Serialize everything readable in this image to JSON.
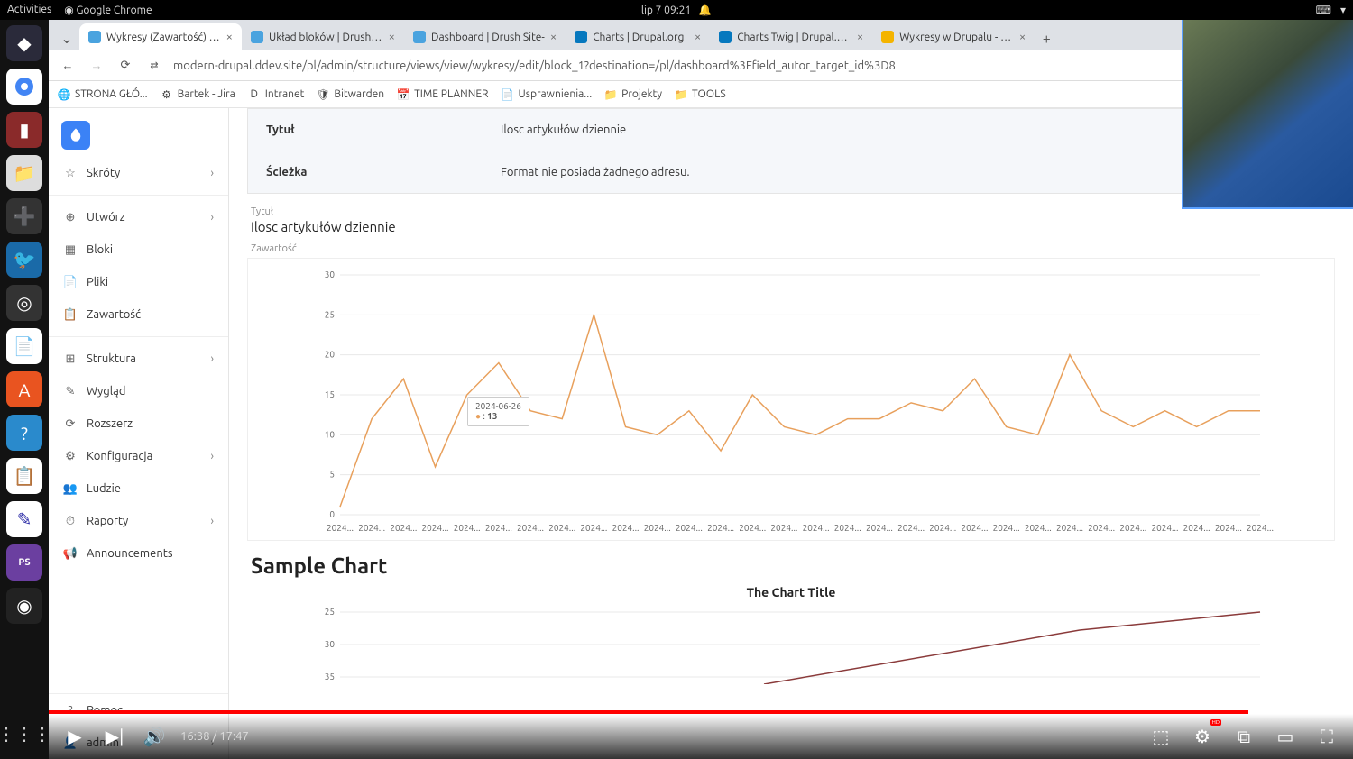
{
  "gnome": {
    "activities": "Activities",
    "app": "Google Chrome",
    "clock": "lip 7  09:21"
  },
  "tabs": [
    {
      "title": "Wykresy (Zawartość) | D",
      "active": true,
      "favicon": "#4aa3df"
    },
    {
      "title": "Układ bloków | Drush Sit",
      "active": false,
      "favicon": "#4aa3df"
    },
    {
      "title": "Dashboard | Drush Site-",
      "active": false,
      "favicon": "#4aa3df"
    },
    {
      "title": "Charts | Drupal.org",
      "active": false,
      "favicon": "#0678be"
    },
    {
      "title": "Charts Twig | Drupal.org",
      "active": false,
      "favicon": "#0678be"
    },
    {
      "title": "Wykresy w Drupalu - Pre",
      "active": false,
      "favicon": "#f4b400"
    }
  ],
  "address": "modern-drupal.ddev.site/pl/admin/structure/views/view/wykresy/edit/block_1?destination=/pl/dashboard%3Ffield_autor_target_id%3D8",
  "bookmarks": [
    {
      "label": "STRONA GŁÓ...",
      "icon": "🌐"
    },
    {
      "label": "Bartek - Jira",
      "icon": "⚙"
    },
    {
      "label": "Intranet",
      "icon": "D"
    },
    {
      "label": "Bitwarden",
      "icon": "🛡"
    },
    {
      "label": "TIME PLANNER",
      "icon": "📅"
    },
    {
      "label": "Usprawnienia...",
      "icon": "📄"
    },
    {
      "label": "Projekty",
      "icon": "📁"
    },
    {
      "label": "TOOLS",
      "icon": "📁"
    }
  ],
  "sidebar": {
    "items": [
      {
        "label": "Skróty",
        "icon": "☆",
        "chev": true
      },
      {
        "label": "Utwórz",
        "icon": "⊕",
        "chev": true
      },
      {
        "label": "Bloki",
        "icon": "▦",
        "chev": false
      },
      {
        "label": "Pliki",
        "icon": "📄",
        "chev": false
      },
      {
        "label": "Zawartość",
        "icon": "📋",
        "chev": false
      },
      {
        "label": "Struktura",
        "icon": "⊞",
        "chev": true
      },
      {
        "label": "Wygląd",
        "icon": "✎",
        "chev": false
      },
      {
        "label": "Rozszerz",
        "icon": "⟳",
        "chev": false
      },
      {
        "label": "Konfiguracja",
        "icon": "⚙",
        "chev": true
      },
      {
        "label": "Ludzie",
        "icon": "👥",
        "chev": false
      },
      {
        "label": "Raporty",
        "icon": "⏱",
        "chev": true
      },
      {
        "label": "Announcements",
        "icon": "📢",
        "chev": false
      }
    ],
    "bottom": [
      {
        "label": "Pomoc",
        "icon": "?"
      },
      {
        "label": "admin",
        "icon": "👤",
        "chev": true
      }
    ]
  },
  "info": {
    "row1_label": "Tytuł",
    "row1_value": "Ilosc artykułów dziennie",
    "row2_label": "Ścieżka",
    "row2_value": "Format nie posiada żadnego adresu."
  },
  "field1_label": "Tytuł",
  "field1_value": "Ilosc artykułów dziennie",
  "field2_label": "Zawartość",
  "tooltip": {
    "date": "2024-06-26",
    "value": "13"
  },
  "sample_heading": "Sample Chart",
  "subchart_title": "The Chart Title",
  "yt": {
    "time_current": "16:38",
    "time_total": "17:47",
    "hd": "HD"
  },
  "chart_data": {
    "type": "line",
    "title": "Ilosc artykułów dziennie",
    "xlabel": "",
    "ylabel": "",
    "ylim": [
      0,
      30
    ],
    "categories": [
      "2024...",
      "2024...",
      "2024...",
      "2024...",
      "2024...",
      "2024...",
      "2024...",
      "2024...",
      "2024...",
      "2024...",
      "2024...",
      "2024...",
      "2024...",
      "2024...",
      "2024...",
      "2024...",
      "2024...",
      "2024...",
      "2024...",
      "2024...",
      "2024...",
      "2024...",
      "2024...",
      "2024...",
      "2024...",
      "2024...",
      "2024...",
      "2024...",
      "2024...",
      "2024..."
    ],
    "values": [
      1,
      12,
      17,
      6,
      15,
      19,
      13,
      12,
      25,
      11,
      10,
      13,
      8,
      15,
      11,
      10,
      12,
      12,
      14,
      13,
      17,
      11,
      10,
      20,
      13,
      11,
      13,
      11,
      13,
      13
    ],
    "yticks": [
      0,
      5,
      10,
      15,
      20,
      25,
      30
    ],
    "tooltip_index": 6
  },
  "subchart_data": {
    "type": "line",
    "title": "The Chart Title",
    "ylim": [
      0,
      35
    ],
    "yticks_visible": [
      25,
      30,
      35
    ]
  }
}
